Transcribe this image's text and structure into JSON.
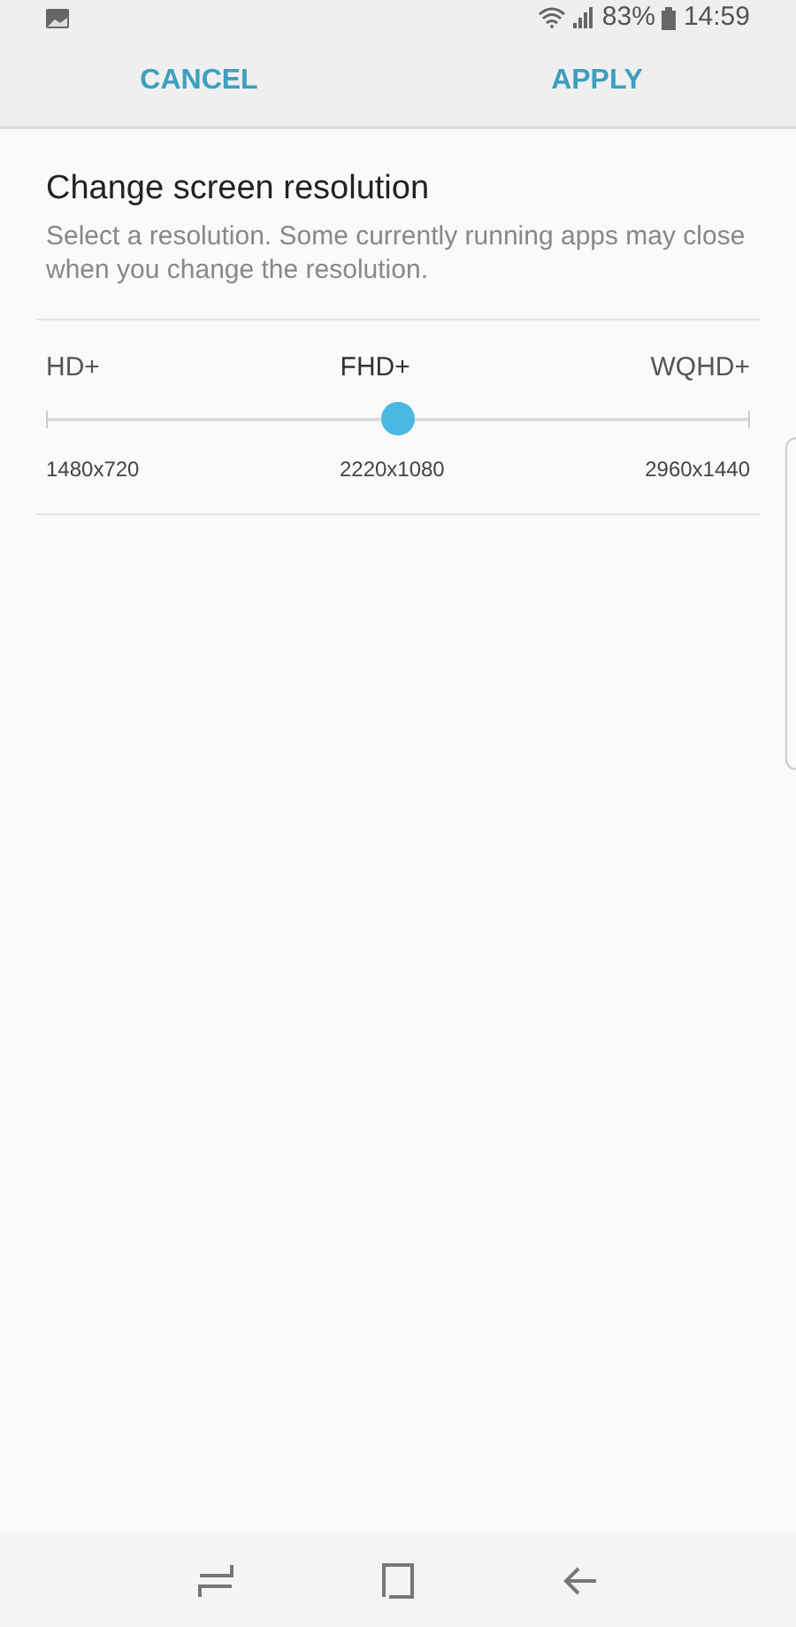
{
  "status_bar": {
    "battery": "83%",
    "time": "14:59"
  },
  "action_bar": {
    "buttons": [
      "CANCEL",
      "APPLY"
    ]
  },
  "title": "Change screen resolution",
  "description": "Select a resolution. Some currently running apps may close when you change the resolution.",
  "resolution_slider": {
    "level": 0.5,
    "options": [
      {
        "name": "HD+",
        "resolution": "1480x720",
        "selected": false
      },
      {
        "name": "FHD+",
        "resolution": "2220x1080",
        "selected": true
      },
      {
        "name": "WQHD+",
        "resolution": "2960x1440",
        "selected": false
      }
    ]
  }
}
